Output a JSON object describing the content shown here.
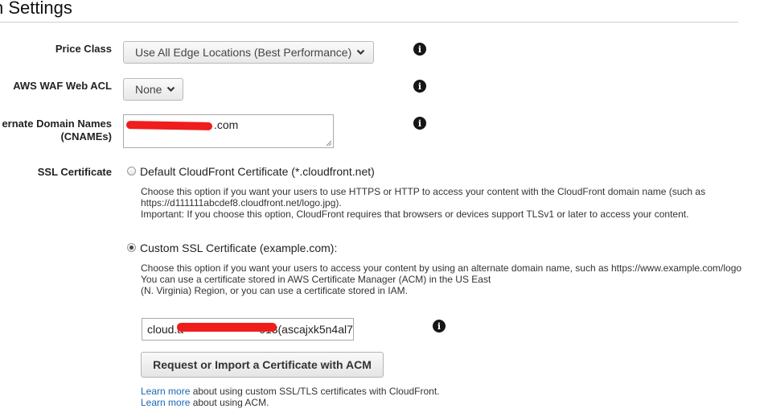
{
  "section": {
    "title": "n Settings"
  },
  "price_class": {
    "label": "Price Class",
    "selected": "Use All Edge Locations (Best Performance)"
  },
  "waf": {
    "label": "AWS WAF Web ACL",
    "selected": "None"
  },
  "cnames": {
    "label_line1": "ernate Domain Names",
    "label_line2": "(CNAMEs)",
    "value": ".com"
  },
  "ssl": {
    "label": "SSL Certificate",
    "default_option": {
      "label": "Default CloudFront Certificate (*.cloudfront.net)",
      "selected": false,
      "help_line1": "Choose this option if you want your users to use HTTPS or HTTP to access your content with the CloudFront domain name (such as",
      "help_line2": "https://d111111abcdef8.cloudfront.net/logo.jpg).",
      "help_line3": "Important: If you choose this option, CloudFront requires that browsers or devices support TLSv1 or later to access your content."
    },
    "custom_option": {
      "label": "Custom SSL Certificate (example.com):",
      "selected": true,
      "help_line1": "Choose this option if you want your users to access your content by using an alternate domain name, such as https://www.example.com/logo",
      "help_line2": "You can use a certificate stored in AWS Certificate Manager (ACM) in the US East",
      "help_line3": "(N. Virginia) Region, or you can use a certificate stored in IAM."
    },
    "certificate_value_start": "cloud.a",
    "certificate_value_mid": "613",
    "certificate_value_end": "(ascajxk5n4al7",
    "acm_button": "Request or Import a Certificate with ACM",
    "learn1_link": "Learn more",
    "learn1_text": " about using custom SSL/TLS certificates with CloudFront.",
    "learn2_link": "Learn more",
    "learn2_text": " about using ACM."
  },
  "icons": {
    "info": "info-icon",
    "chevron": "chevron-down-icon"
  },
  "colors": {
    "link": "#1a66b5",
    "redaction": "#f01d1d"
  }
}
